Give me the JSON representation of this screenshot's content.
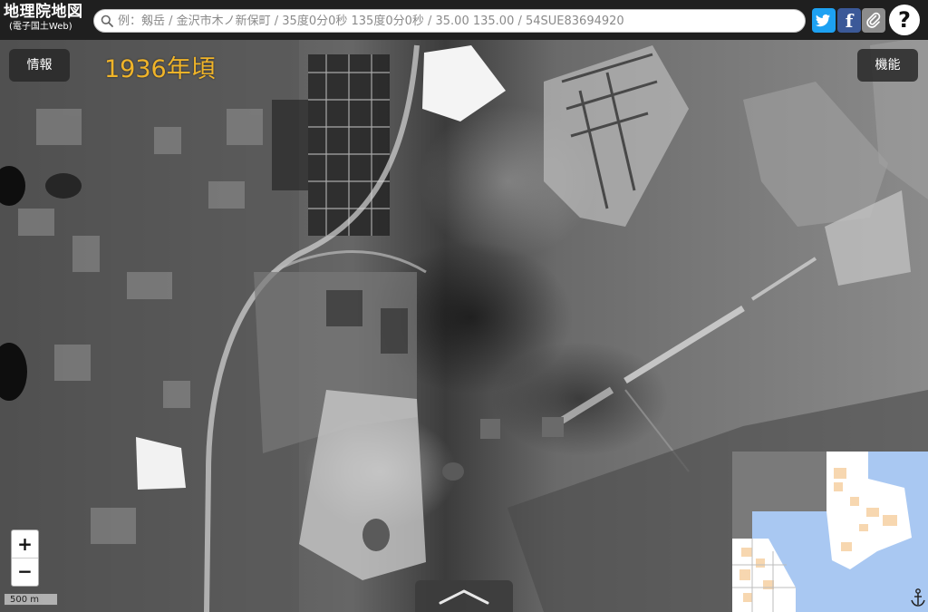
{
  "app": {
    "title": "地理院地図",
    "subtitle": "(電子国土Web)"
  },
  "search": {
    "value": "",
    "placeholder": "例：剱岳 / 金沢市木ノ新保町 / 35度0分0秒 135度0分0秒 / 35.00 135.00 / 54SUE83694920"
  },
  "header_buttons": {
    "facebook_glyph": "f",
    "help_glyph": "?"
  },
  "controls": {
    "info_label": "情報",
    "function_label": "機能",
    "zoom_in": "+",
    "zoom_out": "−",
    "scale_label": "500 m"
  },
  "overlay": {
    "year_label": "1936年頃"
  },
  "icons": [
    "search-icon",
    "twitter-icon",
    "facebook-icon",
    "paperclip-icon",
    "help-icon",
    "chevron-up-icon",
    "anchor-icon"
  ],
  "colors": {
    "header_bg": "#1f1f1f",
    "year_label": "#f0b429",
    "twitter": "#1da1f2",
    "facebook": "#3b5998",
    "minimap_water": "#a9c8f2",
    "minimap_land": "#f7d7b0"
  }
}
